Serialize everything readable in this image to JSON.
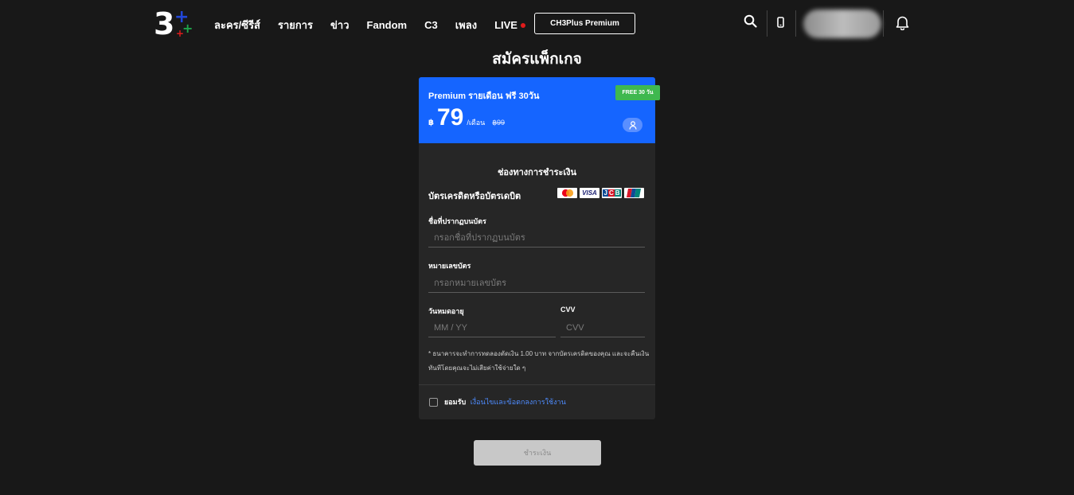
{
  "header": {
    "logo": {
      "number": "3"
    },
    "nav": [
      "ละคร/ซีรีส์",
      "รายการ",
      "ข่าว",
      "Fandom",
      "C3",
      "เพลง",
      "LIVE"
    ],
    "premium_label": "CH3Plus Premium",
    "icons": [
      "search-icon",
      "phone-icon",
      "bell-icon"
    ]
  },
  "page": {
    "title": "สมัครแพ็กเกจ"
  },
  "plan": {
    "name": "Premium รายเดือน ฟรี 30วัน",
    "badge": "FREE 30 วัน",
    "currency": "฿",
    "price": "79",
    "per": "/เดือน",
    "old_price": "฿99",
    "accent_color": "#1565ff",
    "badge_color": "#3fb84f"
  },
  "payment": {
    "section_title": "ช่องทางการชำระเงิน",
    "method_label": "บัตรเครดิตหรือบัตรเดบิต",
    "brands": [
      "mastercard-icon",
      "VISA",
      "JCB",
      "unionpay-icon"
    ],
    "fields": {
      "name": {
        "label": "ชื่อที่ปรากฏบนบัตร",
        "placeholder": "กรอกชื่อที่ปรากฏบนบัตร",
        "value": ""
      },
      "number": {
        "label": "หมายเลขบัตร",
        "placeholder": "กรอกหมายเลขบัตร",
        "value": ""
      },
      "expiry": {
        "label": "วันหมดอายุ",
        "placeholder": "MM / YY",
        "value": ""
      },
      "cvv": {
        "label": "CVV",
        "placeholder": "CVV",
        "value": ""
      }
    },
    "note": "* ธนาคารจะทำการทดลองตัดเงิน 1.00 บาท จากบัตรเครดิตของคุณ และจะคืนเงินทันทีโดยคุณจะไม่เสียค่าใช้จ่ายใด ๆ",
    "agree_bold": "ยอมรับ",
    "agree_link": "เงื่อนไขและข้อตกลงการใช้งาน",
    "agree_checked": false
  },
  "submit_label": "ชำระเงิน"
}
